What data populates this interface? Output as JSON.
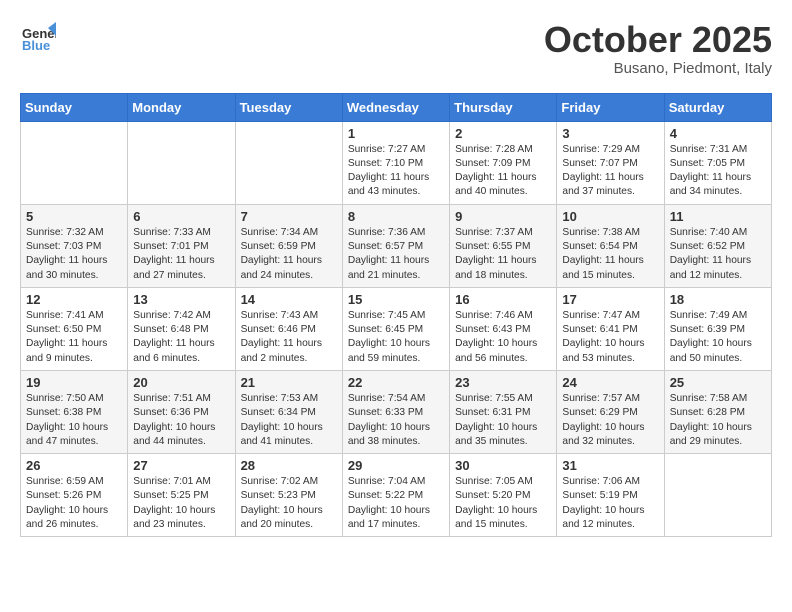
{
  "header": {
    "logo_line1": "General",
    "logo_line2": "Blue",
    "month": "October 2025",
    "location": "Busano, Piedmont, Italy"
  },
  "weekdays": [
    "Sunday",
    "Monday",
    "Tuesday",
    "Wednesday",
    "Thursday",
    "Friday",
    "Saturday"
  ],
  "weeks": [
    [
      {
        "day": "",
        "info": ""
      },
      {
        "day": "",
        "info": ""
      },
      {
        "day": "",
        "info": ""
      },
      {
        "day": "1",
        "info": "Sunrise: 7:27 AM\nSunset: 7:10 PM\nDaylight: 11 hours and 43 minutes."
      },
      {
        "day": "2",
        "info": "Sunrise: 7:28 AM\nSunset: 7:09 PM\nDaylight: 11 hours and 40 minutes."
      },
      {
        "day": "3",
        "info": "Sunrise: 7:29 AM\nSunset: 7:07 PM\nDaylight: 11 hours and 37 minutes."
      },
      {
        "day": "4",
        "info": "Sunrise: 7:31 AM\nSunset: 7:05 PM\nDaylight: 11 hours and 34 minutes."
      }
    ],
    [
      {
        "day": "5",
        "info": "Sunrise: 7:32 AM\nSunset: 7:03 PM\nDaylight: 11 hours and 30 minutes."
      },
      {
        "day": "6",
        "info": "Sunrise: 7:33 AM\nSunset: 7:01 PM\nDaylight: 11 hours and 27 minutes."
      },
      {
        "day": "7",
        "info": "Sunrise: 7:34 AM\nSunset: 6:59 PM\nDaylight: 11 hours and 24 minutes."
      },
      {
        "day": "8",
        "info": "Sunrise: 7:36 AM\nSunset: 6:57 PM\nDaylight: 11 hours and 21 minutes."
      },
      {
        "day": "9",
        "info": "Sunrise: 7:37 AM\nSunset: 6:55 PM\nDaylight: 11 hours and 18 minutes."
      },
      {
        "day": "10",
        "info": "Sunrise: 7:38 AM\nSunset: 6:54 PM\nDaylight: 11 hours and 15 minutes."
      },
      {
        "day": "11",
        "info": "Sunrise: 7:40 AM\nSunset: 6:52 PM\nDaylight: 11 hours and 12 minutes."
      }
    ],
    [
      {
        "day": "12",
        "info": "Sunrise: 7:41 AM\nSunset: 6:50 PM\nDaylight: 11 hours and 9 minutes."
      },
      {
        "day": "13",
        "info": "Sunrise: 7:42 AM\nSunset: 6:48 PM\nDaylight: 11 hours and 6 minutes."
      },
      {
        "day": "14",
        "info": "Sunrise: 7:43 AM\nSunset: 6:46 PM\nDaylight: 11 hours and 2 minutes."
      },
      {
        "day": "15",
        "info": "Sunrise: 7:45 AM\nSunset: 6:45 PM\nDaylight: 10 hours and 59 minutes."
      },
      {
        "day": "16",
        "info": "Sunrise: 7:46 AM\nSunset: 6:43 PM\nDaylight: 10 hours and 56 minutes."
      },
      {
        "day": "17",
        "info": "Sunrise: 7:47 AM\nSunset: 6:41 PM\nDaylight: 10 hours and 53 minutes."
      },
      {
        "day": "18",
        "info": "Sunrise: 7:49 AM\nSunset: 6:39 PM\nDaylight: 10 hours and 50 minutes."
      }
    ],
    [
      {
        "day": "19",
        "info": "Sunrise: 7:50 AM\nSunset: 6:38 PM\nDaylight: 10 hours and 47 minutes."
      },
      {
        "day": "20",
        "info": "Sunrise: 7:51 AM\nSunset: 6:36 PM\nDaylight: 10 hours and 44 minutes."
      },
      {
        "day": "21",
        "info": "Sunrise: 7:53 AM\nSunset: 6:34 PM\nDaylight: 10 hours and 41 minutes."
      },
      {
        "day": "22",
        "info": "Sunrise: 7:54 AM\nSunset: 6:33 PM\nDaylight: 10 hours and 38 minutes."
      },
      {
        "day": "23",
        "info": "Sunrise: 7:55 AM\nSunset: 6:31 PM\nDaylight: 10 hours and 35 minutes."
      },
      {
        "day": "24",
        "info": "Sunrise: 7:57 AM\nSunset: 6:29 PM\nDaylight: 10 hours and 32 minutes."
      },
      {
        "day": "25",
        "info": "Sunrise: 7:58 AM\nSunset: 6:28 PM\nDaylight: 10 hours and 29 minutes."
      }
    ],
    [
      {
        "day": "26",
        "info": "Sunrise: 6:59 AM\nSunset: 5:26 PM\nDaylight: 10 hours and 26 minutes."
      },
      {
        "day": "27",
        "info": "Sunrise: 7:01 AM\nSunset: 5:25 PM\nDaylight: 10 hours and 23 minutes."
      },
      {
        "day": "28",
        "info": "Sunrise: 7:02 AM\nSunset: 5:23 PM\nDaylight: 10 hours and 20 minutes."
      },
      {
        "day": "29",
        "info": "Sunrise: 7:04 AM\nSunset: 5:22 PM\nDaylight: 10 hours and 17 minutes."
      },
      {
        "day": "30",
        "info": "Sunrise: 7:05 AM\nSunset: 5:20 PM\nDaylight: 10 hours and 15 minutes."
      },
      {
        "day": "31",
        "info": "Sunrise: 7:06 AM\nSunset: 5:19 PM\nDaylight: 10 hours and 12 minutes."
      },
      {
        "day": "",
        "info": ""
      }
    ]
  ]
}
